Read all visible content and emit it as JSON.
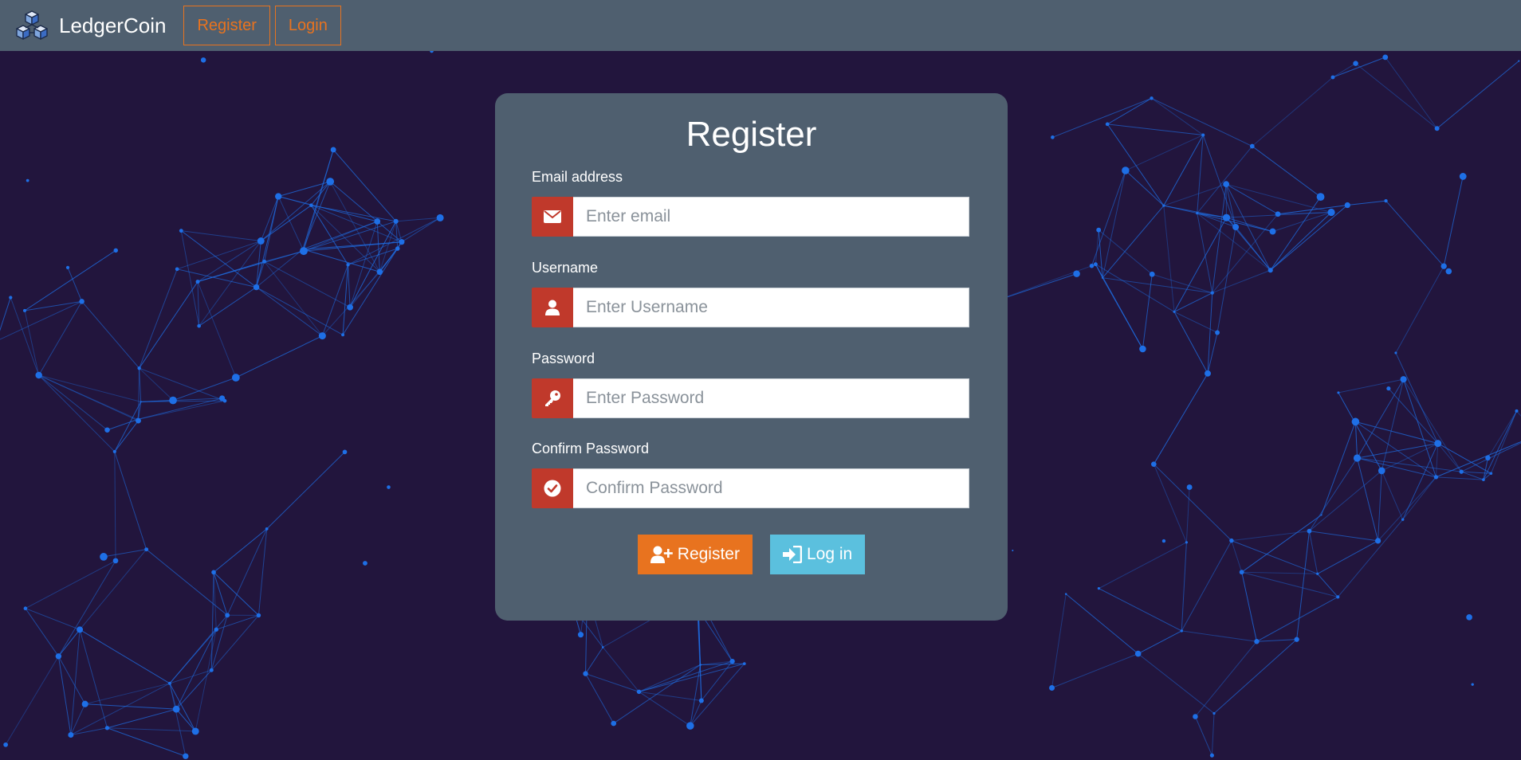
{
  "app": {
    "brand_name": "LedgerCoin"
  },
  "navbar": {
    "register_label": "Register",
    "login_label": "Login"
  },
  "form": {
    "title": "Register",
    "fields": [
      {
        "label": "Email address",
        "placeholder": "Enter email",
        "value": "",
        "icon": "envelope-icon"
      },
      {
        "label": "Username",
        "placeholder": "Enter Username",
        "value": "",
        "icon": "user-icon"
      },
      {
        "label": "Password",
        "placeholder": "Enter Password",
        "value": "",
        "icon": "key-icon"
      },
      {
        "label": "Confirm Password",
        "placeholder": "Confirm Password",
        "value": "",
        "icon": "check-circle-icon"
      }
    ],
    "register_button": {
      "label": "Register",
      "icon": "user-plus-icon"
    },
    "login_button": {
      "label": "Log in",
      "icon": "sign-in-icon"
    }
  },
  "colors": {
    "background": "#22153d",
    "navbar": "#4f5f6f",
    "accent_orange": "#e8731f",
    "icon_red": "#c0392b",
    "login_blue": "#5bc0de",
    "network_blue": "#1e6fe6"
  }
}
